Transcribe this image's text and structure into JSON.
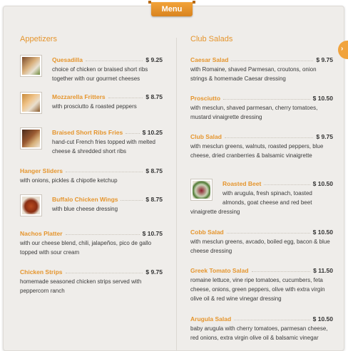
{
  "header": {
    "tab_label": "Menu"
  },
  "appetizers": {
    "title": "Appetizers",
    "items": [
      {
        "name": "Quesadilla",
        "price": "$ 9.25",
        "desc": "choice of chicken or braised short ribs together with our gourmet cheeses"
      },
      {
        "name": "Mozzarella Fritters",
        "price": "$ 8.75",
        "desc": "with prosciutto & roasted peppers"
      },
      {
        "name": "Braised Short Ribs Fries",
        "price": "$ 10.25",
        "desc": "hand-cut French fries topped with melted cheese & shredded short ribs"
      },
      {
        "name": "Hanger Sliders",
        "price": "$ 8.75",
        "desc": "with onions, pickles & chipotle ketchup"
      },
      {
        "name": "Buffalo Chicken Wings",
        "price": "$ 8.75",
        "desc": "with blue cheese dressing"
      },
      {
        "name": "Nachos Platter",
        "price": "$ 10.75",
        "desc": "with our cheese blend, chili, jalapeños, pico de gallo topped with sour cream"
      },
      {
        "name": "Chicken Strips",
        "price": "$ 9.75",
        "desc": "homemade seasoned chicken strips served with peppercorn ranch"
      }
    ]
  },
  "club_salads": {
    "title": "Club Salads",
    "items": [
      {
        "name": "Caesar Salad",
        "price": "$ 9.75",
        "desc": "with Romaine, shaved Parmesan, croutons, onion strings & homemade Caesar dressing"
      },
      {
        "name": "Prosciutto",
        "price": "$ 10.50",
        "desc": "with mesclun, shaved parmesan, cherry tomatoes, mustard vinaigrette dressing"
      },
      {
        "name": "Club Salad",
        "price": "$ 9.75",
        "desc": "with mesclun greens, walnuts, roasted peppers, blue cheese, dried cranberries & balsamic vinaigrette"
      },
      {
        "name": "Roasted Beet",
        "price": "$ 10.50",
        "desc_a": "with arugula, fresh spinach, toasted almonds, goat cheese and red beet",
        "desc_b": "vinaigrette dressing"
      },
      {
        "name": "Cobb Salad",
        "price": "$ 10.50",
        "desc": "with mesclun greens, avcado, boiled egg, bacon & blue cheese dressing"
      },
      {
        "name": "Greek Tomato Salad",
        "price": "$ 11.50",
        "desc": "romaine lettuce, vine ripe tomatoes, cucumbers, feta cheese, onions, green peppers, olive with extra virgin olive oil & red wine vinegar dressing"
      },
      {
        "name": "Arugula Salad",
        "price": "$ 10.50",
        "desc": "baby arugula with cherry tomatoes, parmesan cheese, red onions, extra virgin olive oil & balsamic vinegar"
      }
    ]
  },
  "colors": {
    "accent": "#e5952d",
    "tab": "#e0902a",
    "background": "#efedea"
  },
  "icons": {
    "side_tab": "chevron-right-icon"
  }
}
